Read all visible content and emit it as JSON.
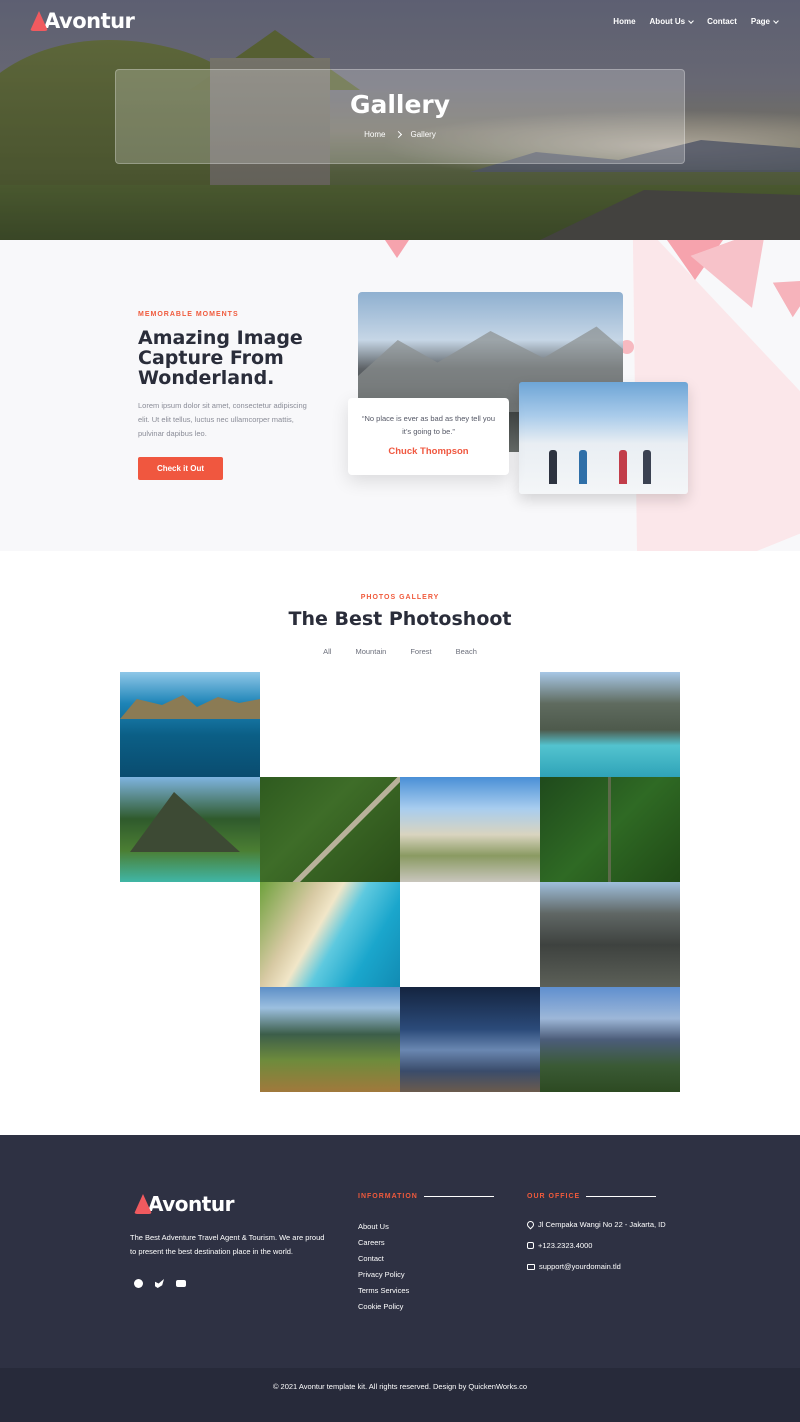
{
  "brand": {
    "name": "Avontur",
    "accent": "#f05a3c"
  },
  "nav": {
    "items": [
      {
        "label": "Home",
        "has_dropdown": false
      },
      {
        "label": "About Us",
        "has_dropdown": true
      },
      {
        "label": "Contact",
        "has_dropdown": false
      },
      {
        "label": "Page",
        "has_dropdown": true
      }
    ]
  },
  "hero": {
    "title": "Gallery",
    "breadcrumb": [
      "Home",
      "Gallery"
    ]
  },
  "about": {
    "eyebrow": "MEMORABLE MOMENTS",
    "title": "Amazing Image Capture From Wonderland.",
    "text": "Lorem ipsum dolor sit amet, consectetur adipiscing elit. Ut elit tellus, luctus nec ullamcorper mattis, pulvinar dapibus leo.",
    "button": "Check it Out",
    "quote": "“No place is ever as bad as they tell you it’s going to be.”",
    "quote_author": "Chuck Thompson"
  },
  "gallery": {
    "eyebrow": "PHOTOS GALLERY",
    "title": "The Best Photoshoot",
    "filters": [
      "All",
      "Mountain",
      "Forest",
      "Beach"
    ]
  },
  "footer": {
    "about": "The Best Adventure Travel Agent & Tourism. We are proud to present the best destination place in the world.",
    "social_icons": [
      "facebook-icon",
      "twitter-icon",
      "youtube-icon"
    ],
    "information_heading": "INFORMATION",
    "links": [
      "About Us",
      "Careers",
      "Contact",
      "Privacy Policy",
      "Terms Services",
      "Cookie Policy"
    ],
    "office_heading": "OUR OFFICE",
    "address": "Jl Cempaka Wangi No 22 - Jakarta, ID",
    "phone": "+123.2323.4000",
    "email": "support@yourdomain.tld",
    "copyright": "© 2021 Avontur template kit. All rights reserved. Design by QuickenWorks.co"
  }
}
